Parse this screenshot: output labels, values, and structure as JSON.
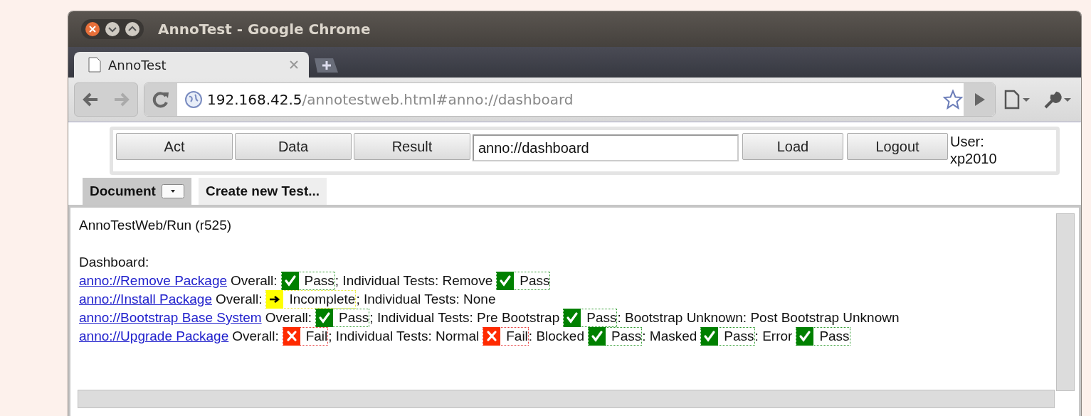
{
  "window": {
    "title": "AnnoTest - Google Chrome"
  },
  "tabs": [
    {
      "label": "AnnoTest",
      "selected": true
    }
  ],
  "address_bar": {
    "host": "192.168.42.5",
    "path": "/annotestweb.html#anno://dashboard"
  },
  "toolbar": {
    "buttons": [
      "Act",
      "Data",
      "Result"
    ],
    "address_field": {
      "value": "anno://dashboard"
    },
    "action_buttons": [
      "Load",
      "Logout"
    ],
    "user": "User: xp2010"
  },
  "page_tabs": [
    {
      "label": "Document",
      "selected": true,
      "dropdown": true
    },
    {
      "label": "Create new Test...",
      "selected": false,
      "dropdown": false
    }
  ],
  "content": {
    "heading": "AnnoTestWeb/Run (r525)",
    "section": "Dashboard:",
    "lines": [
      {
        "segments": [
          {
            "kind": "link",
            "text": "anno://Remove Package"
          },
          {
            "kind": "text",
            "text": "Overall:"
          },
          {
            "kind": "pass",
            "text": "Pass"
          },
          {
            "kind": "text",
            "text": "; Individual Tests: Remove"
          },
          {
            "kind": "pass",
            "text": "Pass"
          }
        ]
      },
      {
        "segments": [
          {
            "kind": "link",
            "text": "anno://Install Package"
          },
          {
            "kind": "text",
            "text": "Overall:"
          },
          {
            "kind": "incomplete",
            "text": "Incomplete"
          },
          {
            "kind": "text",
            "text": "; Individual Tests: None"
          }
        ]
      },
      {
        "segments": [
          {
            "kind": "link",
            "text": "anno://Bootstrap Base System"
          },
          {
            "kind": "text",
            "text": "Overall:"
          },
          {
            "kind": "pass",
            "text": "Pass"
          },
          {
            "kind": "text",
            "text": "; Individual Tests: Pre Bootstrap"
          },
          {
            "kind": "pass",
            "text": "Pass"
          },
          {
            "kind": "text",
            "text": ": Bootstrap Unknown: Post Bootstrap Unknown"
          }
        ]
      },
      {
        "segments": [
          {
            "kind": "link",
            "text": "anno://Upgrade Package"
          },
          {
            "kind": "text",
            "text": "Overall:"
          },
          {
            "kind": "fail",
            "text": "Fail"
          },
          {
            "kind": "text",
            "text": "; Individual Tests: Normal"
          },
          {
            "kind": "fail",
            "text": "Fail"
          },
          {
            "kind": "text",
            "text": ": Blocked"
          },
          {
            "kind": "pass",
            "text": "Pass"
          },
          {
            "kind": "text",
            "text": ": Masked"
          },
          {
            "kind": "pass",
            "text": "Pass"
          },
          {
            "kind": "text",
            "text": ": Error"
          },
          {
            "kind": "pass",
            "text": "Pass"
          }
        ]
      }
    ]
  }
}
